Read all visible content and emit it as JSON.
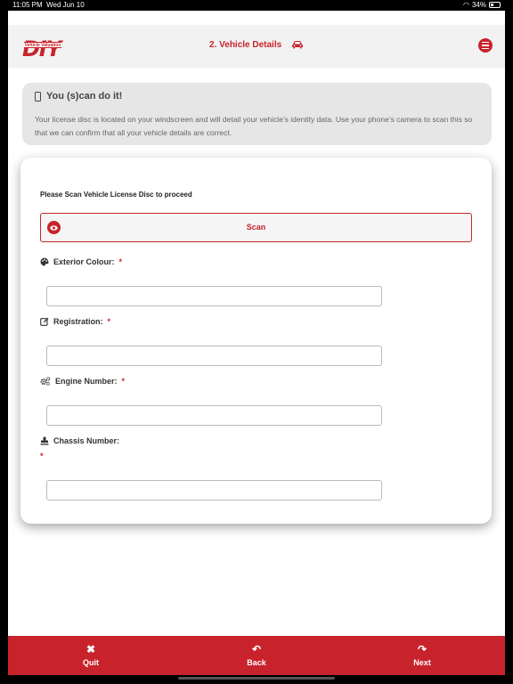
{
  "status": {
    "time": "11:05 PM",
    "date": "Wed Jun 10",
    "battery": "34%"
  },
  "header": {
    "logo_text": "DIY",
    "logo_strip": "Vehicle Valuation",
    "title": "2. Vehicle Details"
  },
  "info": {
    "title": "You (s)can do it!",
    "text": "Your license disc is located on your windscreen and will detail your vehicle’s identity data. Use your phone’s camera to scan this so that we can confirm that all your vehicle details are correct."
  },
  "form": {
    "prompt": "Please Scan Vehicle License Disc to proceed",
    "scan_label": "Scan",
    "required_mark": "*",
    "fields": [
      {
        "label": "Exterior Colour:",
        "value": "",
        "icon": "palette-icon"
      },
      {
        "label": "Registration:",
        "value": "",
        "icon": "edit-icon"
      },
      {
        "label": "Engine Number:",
        "value": "",
        "icon": "cogs-icon"
      },
      {
        "label": "Chassis Number:",
        "value": "",
        "icon": "stamp-icon"
      }
    ]
  },
  "nav": {
    "quit": "Quit",
    "back": "Back",
    "next": "Next"
  },
  "colors": {
    "brand_red": "#c8232c",
    "header_bg": "#f2f2f2",
    "info_bg": "#e6e6e6"
  }
}
